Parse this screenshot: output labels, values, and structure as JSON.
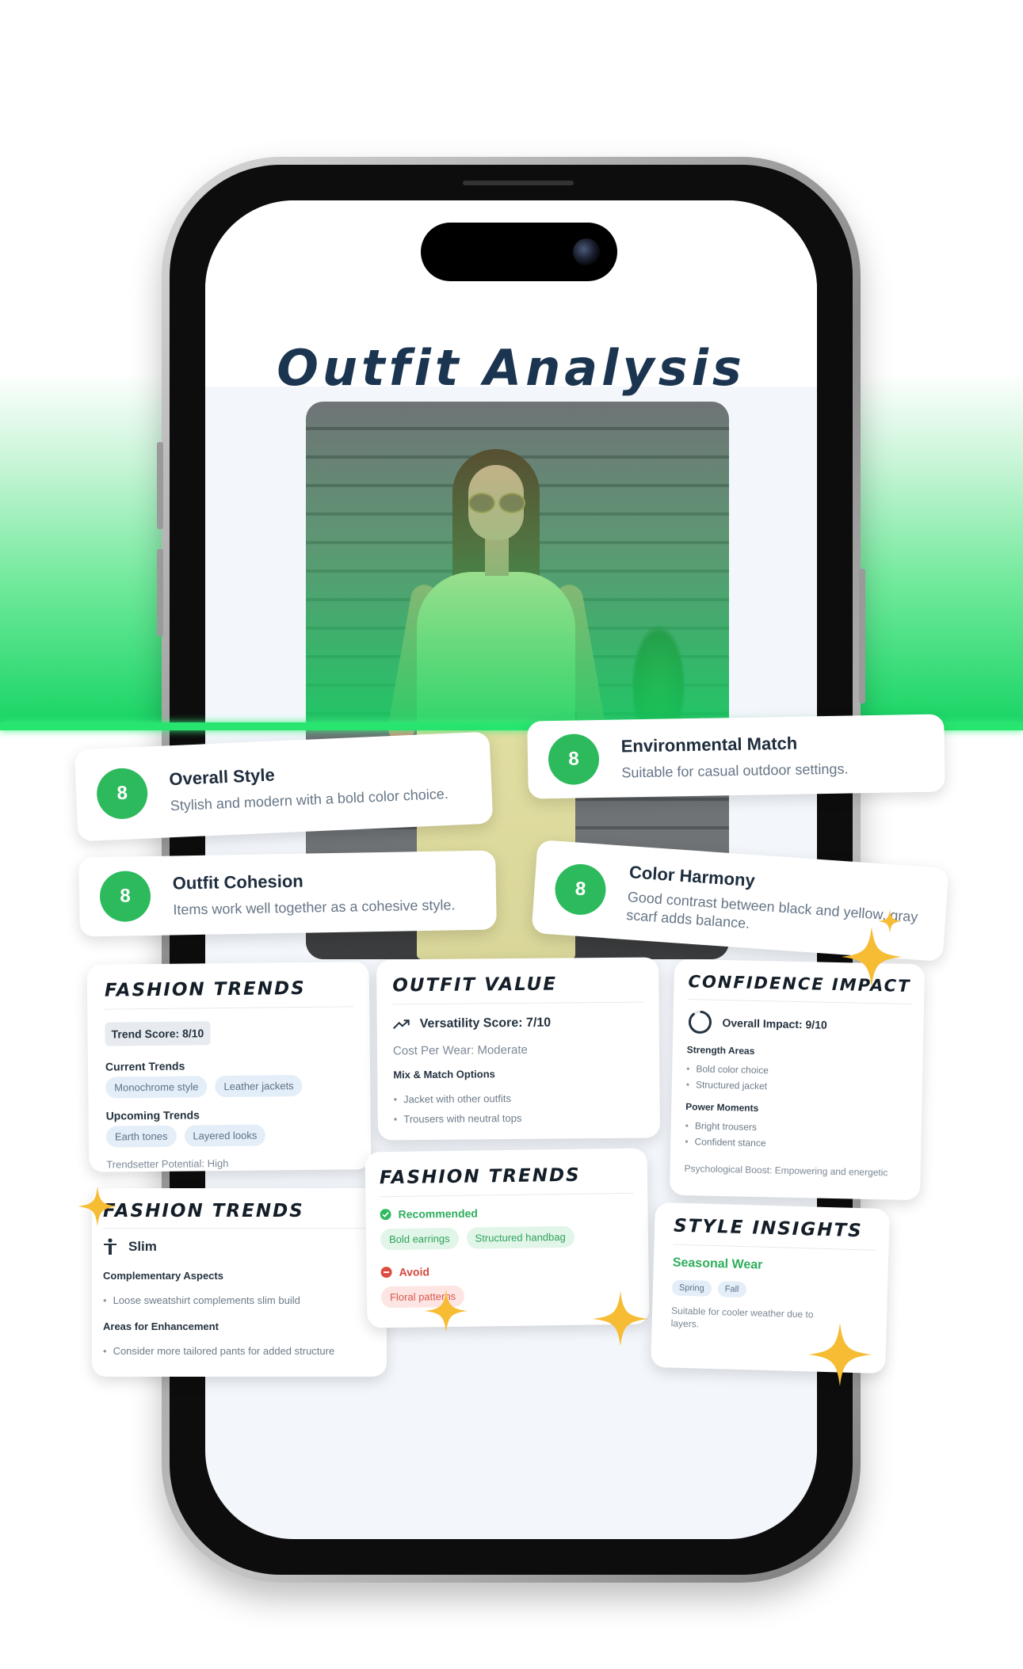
{
  "header": {
    "title": "Outfit Analysis"
  },
  "score_cards": [
    {
      "score": "8",
      "title": "Overall Style",
      "desc": "Stylish and modern with a bold color choice."
    },
    {
      "score": "8",
      "title": "Environmental Match",
      "desc": "Suitable for casual outdoor settings."
    },
    {
      "score": "8",
      "title": "Outfit Cohesion",
      "desc": "Items work well together as a cohesive style."
    },
    {
      "score": "8",
      "title": "Color Harmony",
      "desc1": "Good contrast between black and yellow, gray",
      "desc2": "scarf adds balance."
    }
  ],
  "fashion_trends_1": {
    "title": "FASHION TRENDS",
    "score": "Trend Score: 8/10",
    "current_label": "Current Trends",
    "current": [
      "Monochrome style",
      "Leather jackets"
    ],
    "upcoming_label": "Upcoming Trends",
    "upcoming": [
      "Earth tones",
      "Layered looks"
    ],
    "potential": "Trendsetter Potential: High"
  },
  "outfit_value": {
    "title": "OUTFIT VALUE",
    "versatility": "Versatility Score: 7/10",
    "cost": "Cost Per Wear: Moderate",
    "mix_label": "Mix & Match Options",
    "options": [
      "Jacket with other outfits",
      "Trousers with neutral tops"
    ]
  },
  "confidence": {
    "title": "CONFIDENCE IMPACT",
    "overall": "Overall Impact: 9/10",
    "strength_label": "Strength Areas",
    "strengths": [
      "Bold color choice",
      "Structured jacket"
    ],
    "power_label": "Power Moments",
    "power": [
      "Bright trousers",
      "Confident stance"
    ],
    "boost": "Psychological Boost: Empowering and energetic"
  },
  "fashion_trends_2": {
    "title": "FASHION TRENDS",
    "body_type": "Slim",
    "comp_label": "Complementary Aspects",
    "comp": [
      "Loose sweatshirt complements slim build"
    ],
    "enh_label": "Areas for Enhancement",
    "enh": [
      "Consider more tailored pants for added structure"
    ]
  },
  "fashion_trends_3": {
    "title": "FASHION TRENDS",
    "rec_label": "Recommended",
    "rec": [
      "Bold earrings",
      "Structured handbag"
    ],
    "avoid_label": "Avoid",
    "avoid": [
      "Floral patterns"
    ]
  },
  "style_insights": {
    "title": "STYLE INSIGHTS",
    "season_label": "Seasonal Wear",
    "seasons": [
      "Spring",
      "Fall"
    ],
    "note1": "Suitable for cooler weather due to",
    "note2": "layers."
  },
  "colors": {
    "accent_green": "#2dba5d",
    "title_navy": "#1b3550",
    "sparkle": "#f6bc34",
    "band_green": "#16d463"
  },
  "icons": [
    "trend-up-icon",
    "progress-ring-icon",
    "person-icon",
    "check-circle-icon",
    "minus-circle-icon",
    "sparkle-icon"
  ]
}
